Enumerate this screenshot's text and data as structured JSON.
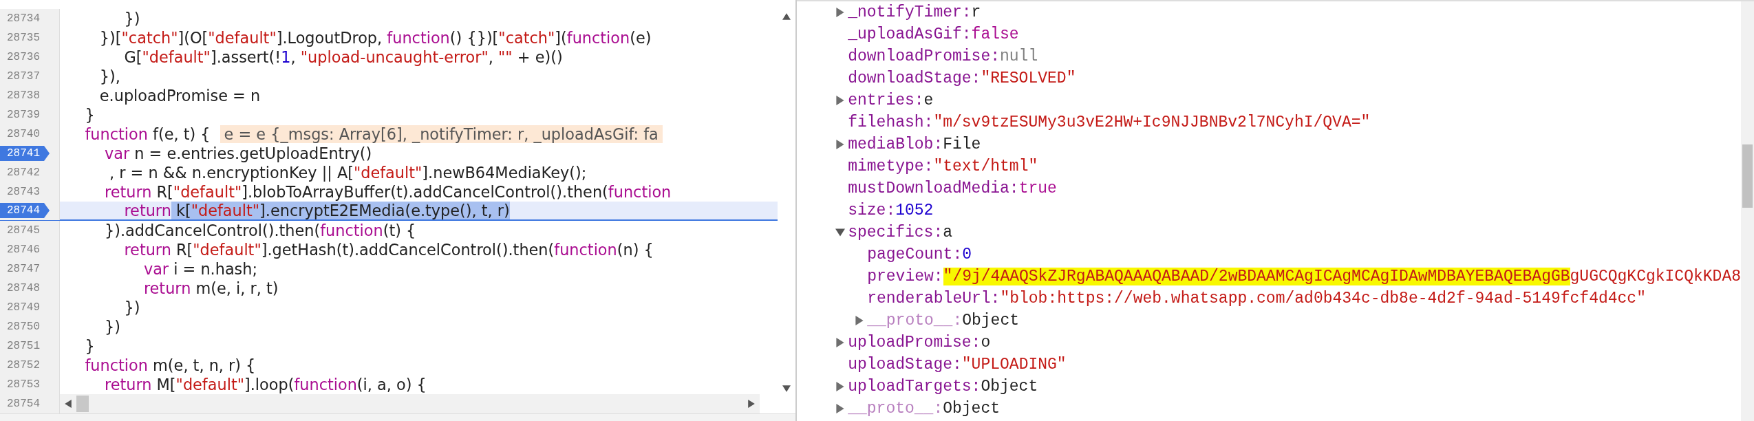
{
  "source": {
    "lines": [
      {
        "number": "28734",
        "breakpoint": false,
        "paused": false,
        "tokens": [
          {
            "kind": "plain",
            "text": "            })"
          }
        ]
      },
      {
        "number": "28735",
        "breakpoint": false,
        "paused": false,
        "tokens": [
          {
            "kind": "plain",
            "text": "       })["
          },
          {
            "kind": "string",
            "text": "\"catch\""
          },
          {
            "kind": "plain",
            "text": "](O["
          },
          {
            "kind": "string",
            "text": "\"default\""
          },
          {
            "kind": "plain",
            "text": "].LogoutDrop, "
          },
          {
            "kind": "keyword",
            "text": "function"
          },
          {
            "kind": "plain",
            "text": "() {})["
          },
          {
            "kind": "string",
            "text": "\"catch\""
          },
          {
            "kind": "plain",
            "text": "]("
          },
          {
            "kind": "keyword",
            "text": "function"
          },
          {
            "kind": "plain",
            "text": "(e)"
          }
        ]
      },
      {
        "number": "28736",
        "breakpoint": false,
        "paused": false,
        "tokens": [
          {
            "kind": "plain",
            "text": "            G["
          },
          {
            "kind": "string",
            "text": "\"default\""
          },
          {
            "kind": "plain",
            "text": "].assert(!"
          },
          {
            "kind": "number",
            "text": "1"
          },
          {
            "kind": "plain",
            "text": ", "
          },
          {
            "kind": "string",
            "text": "\"upload-uncaught-error\""
          },
          {
            "kind": "plain",
            "text": ", "
          },
          {
            "kind": "string",
            "text": "\"\""
          },
          {
            "kind": "plain",
            "text": " + e)()"
          }
        ]
      },
      {
        "number": "28737",
        "breakpoint": false,
        "paused": false,
        "tokens": [
          {
            "kind": "plain",
            "text": "       }),"
          }
        ]
      },
      {
        "number": "28738",
        "breakpoint": false,
        "paused": false,
        "tokens": [
          {
            "kind": "plain",
            "text": "       e.uploadPromise = n"
          }
        ]
      },
      {
        "number": "28739",
        "breakpoint": false,
        "paused": false,
        "tokens": [
          {
            "kind": "plain",
            "text": "    }"
          }
        ]
      },
      {
        "number": "28740",
        "breakpoint": false,
        "paused": false,
        "tokens": [
          {
            "kind": "keyword",
            "text": "    function"
          },
          {
            "kind": "plain",
            "text": " f(e, t) {"
          }
        ],
        "inline_value": "e = e {_msgs: Array[6], _notifyTimer: r, _uploadAsGif: fa"
      },
      {
        "number": "28741",
        "breakpoint": true,
        "paused": false,
        "tokens": [
          {
            "kind": "keyword",
            "text": "        var"
          },
          {
            "kind": "plain",
            "text": " n = e.entries.getUploadEntry()"
          }
        ]
      },
      {
        "number": "28742",
        "breakpoint": false,
        "paused": false,
        "tokens": [
          {
            "kind": "plain",
            "text": "         , r = n && n.encryptionKey || A["
          },
          {
            "kind": "string",
            "text": "\"default\""
          },
          {
            "kind": "plain",
            "text": "].newB64MediaKey();"
          }
        ]
      },
      {
        "number": "28743",
        "breakpoint": false,
        "paused": false,
        "tokens": [
          {
            "kind": "keyword",
            "text": "        return"
          },
          {
            "kind": "plain",
            "text": " R["
          },
          {
            "kind": "string",
            "text": "\"default\""
          },
          {
            "kind": "plain",
            "text": "].blobToArrayBuffer(t).addCancelControl().then("
          },
          {
            "kind": "keyword",
            "text": "function"
          }
        ]
      },
      {
        "number": "28744",
        "breakpoint": true,
        "paused": true,
        "tokens": [
          {
            "kind": "keyword",
            "text": "            return"
          },
          {
            "kind": "plain",
            "text": " k["
          },
          {
            "kind": "string",
            "text": "\"default\""
          },
          {
            "kind": "plain",
            "text": "].encryptE2EMedia(e.type(), t, r)"
          }
        ]
      },
      {
        "number": "28745",
        "breakpoint": false,
        "paused": false,
        "tokens": [
          {
            "kind": "plain",
            "text": "        }).addCancelControl().then("
          },
          {
            "kind": "keyword",
            "text": "function"
          },
          {
            "kind": "plain",
            "text": "(t) {"
          }
        ]
      },
      {
        "number": "28746",
        "breakpoint": false,
        "paused": false,
        "tokens": [
          {
            "kind": "keyword",
            "text": "            return"
          },
          {
            "kind": "plain",
            "text": " R["
          },
          {
            "kind": "string",
            "text": "\"default\""
          },
          {
            "kind": "plain",
            "text": "].getHash(t).addCancelControl().then("
          },
          {
            "kind": "keyword",
            "text": "function"
          },
          {
            "kind": "plain",
            "text": "(n) {"
          }
        ]
      },
      {
        "number": "28747",
        "breakpoint": false,
        "paused": false,
        "tokens": [
          {
            "kind": "keyword",
            "text": "                var"
          },
          {
            "kind": "plain",
            "text": " i = n.hash;"
          }
        ]
      },
      {
        "number": "28748",
        "breakpoint": false,
        "paused": false,
        "tokens": [
          {
            "kind": "keyword",
            "text": "                return"
          },
          {
            "kind": "plain",
            "text": " m(e, i, r, t)"
          }
        ]
      },
      {
        "number": "28749",
        "breakpoint": false,
        "paused": false,
        "tokens": [
          {
            "kind": "plain",
            "text": "            })"
          }
        ]
      },
      {
        "number": "28750",
        "breakpoint": false,
        "paused": false,
        "tokens": [
          {
            "kind": "plain",
            "text": "        })"
          }
        ]
      },
      {
        "number": "28751",
        "breakpoint": false,
        "paused": false,
        "tokens": [
          {
            "kind": "plain",
            "text": "    }"
          }
        ]
      },
      {
        "number": "28752",
        "breakpoint": false,
        "paused": false,
        "tokens": [
          {
            "kind": "keyword",
            "text": "    function"
          },
          {
            "kind": "plain",
            "text": " m(e, t, n, r) {"
          }
        ]
      },
      {
        "number": "28753",
        "breakpoint": false,
        "paused": false,
        "tokens": [
          {
            "kind": "keyword",
            "text": "        return"
          },
          {
            "kind": "plain",
            "text": " M["
          },
          {
            "kind": "string",
            "text": "\"default\""
          },
          {
            "kind": "plain",
            "text": "].loop("
          },
          {
            "kind": "keyword",
            "text": "function"
          },
          {
            "kind": "plain",
            "text": "(i, a, o) {"
          }
        ]
      },
      {
        "number": "28754",
        "breakpoint": false,
        "paused": false
      }
    ]
  },
  "scope": {
    "properties": [
      {
        "name": "_notifyTimer:",
        "value": "r",
        "kind": "object",
        "enumerable": true,
        "expandable": true,
        "expanded": false
      },
      {
        "name": "_uploadAsGif:",
        "value": "false",
        "kind": "boolean",
        "enumerable": true,
        "expandable": false
      },
      {
        "name": "downloadPromise:",
        "value": "null",
        "kind": "null",
        "enumerable": true,
        "expandable": false
      },
      {
        "name": "downloadStage:",
        "value": "\"RESOLVED\"",
        "kind": "string",
        "enumerable": true,
        "expandable": false
      },
      {
        "name": "entries:",
        "value": "e",
        "kind": "object",
        "enumerable": true,
        "expandable": true,
        "expanded": false
      },
      {
        "name": "filehash:",
        "value": "\"m/sv9tzESUMy3u3vE2HW+Ic9NJJBNBv2l7NCyhI/QVA=\"",
        "kind": "string",
        "enumerable": true,
        "expandable": false
      },
      {
        "name": "mediaBlob:",
        "value": "File",
        "kind": "object",
        "enumerable": true,
        "expandable": true,
        "expanded": false
      },
      {
        "name": "mimetype:",
        "value": "\"text/html\"",
        "kind": "string",
        "enumerable": true,
        "expandable": false
      },
      {
        "name": "mustDownloadMedia:",
        "value": "true",
        "kind": "boolean",
        "enumerable": true,
        "expandable": false
      },
      {
        "name": "size:",
        "value": "1052",
        "kind": "number",
        "enumerable": true,
        "expandable": false
      },
      {
        "name": "specifics:",
        "value": "a",
        "kind": "object",
        "enumerable": true,
        "expandable": true,
        "expanded": true,
        "children": [
          {
            "name": "pageCount:",
            "value": "0",
            "kind": "number",
            "enumerable": true,
            "expandable": false
          },
          {
            "name": "preview:",
            "value_highlighted": "\"/9j/4AAQSkZJRgABAQAAAQABAAD/2wBDAAMCAgICAgMCAgIDAwMDBAYEBAQEBAgGB",
            "value": "gUGCQgKCgkICQkKDA8",
            "kind": "string",
            "enumerable": true,
            "expandable": false
          },
          {
            "name": "renderableUrl:",
            "value": "\"blob:https://web.whatsapp.com/ad0b434c-db8e-4d2f-94ad-5149fcf4d4cc\"",
            "kind": "string",
            "enumerable": true,
            "expandable": false
          },
          {
            "name": "__proto__:",
            "value": "Object",
            "kind": "object",
            "enumerable": false,
            "expandable": true,
            "expanded": false
          }
        ]
      },
      {
        "name": "uploadPromise:",
        "value": "o",
        "kind": "object",
        "enumerable": true,
        "expandable": true,
        "expanded": false
      },
      {
        "name": "uploadStage:",
        "value": "\"UPLOADING\"",
        "kind": "string",
        "enumerable": true,
        "expandable": false
      },
      {
        "name": "uploadTargets:",
        "value": "Object",
        "kind": "object",
        "enumerable": true,
        "expandable": true,
        "expanded": false
      },
      {
        "name": "__proto__:",
        "value": "Object",
        "kind": "object",
        "enumerable": false,
        "expandable": true,
        "expanded": false
      }
    ]
  }
}
